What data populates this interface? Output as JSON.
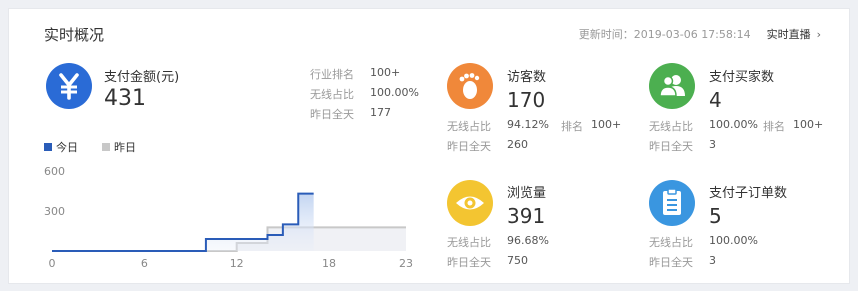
{
  "header": {
    "title": "实时概况",
    "update_label": "更新时间：2019-03-06 17:58:14",
    "live_link": "实时直播"
  },
  "pay_amount": {
    "icon": "yen-icon",
    "color": "#2a6bd6",
    "label": "支付金额(元)",
    "value": "431",
    "stats": [
      {
        "k": "行业排名",
        "v": "100+"
      },
      {
        "k": "无线占比",
        "v": "100.00%"
      },
      {
        "k": "昨日全天",
        "v": "177"
      }
    ]
  },
  "visitors": {
    "icon": "footprint-icon",
    "color": "#f0883a",
    "label": "访客数",
    "value": "170",
    "wireless_k": "无线占比",
    "wireless_v": "94.12%",
    "rank_k": "排名",
    "rank_v": "100+",
    "yesterday_k": "昨日全天",
    "yesterday_v": "260"
  },
  "buyers": {
    "icon": "users-icon",
    "color": "#4caf50",
    "label": "支付买家数",
    "value": "4",
    "wireless_k": "无线占比",
    "wireless_v": "100.00%",
    "rank_k": "排名",
    "rank_v": "100+",
    "yesterday_k": "昨日全天",
    "yesterday_v": "3"
  },
  "pageviews": {
    "icon": "eye-icon",
    "color": "#f3c531",
    "label": "浏览量",
    "value": "391",
    "wireless_k": "无线占比",
    "wireless_v": "96.68%",
    "yesterday_k": "昨日全天",
    "yesterday_v": "750"
  },
  "suborders": {
    "icon": "clipboard-icon",
    "color": "#3a96e0",
    "label": "支付子订单数",
    "value": "5",
    "wireless_k": "无线占比",
    "wireless_v": "100.00%",
    "yesterday_k": "昨日全天",
    "yesterday_v": "3"
  },
  "chart_data": {
    "type": "line",
    "x": [
      0,
      1,
      2,
      3,
      4,
      5,
      6,
      7,
      8,
      9,
      10,
      11,
      12,
      13,
      14,
      15,
      16,
      17,
      18,
      19,
      20,
      21,
      22,
      23
    ],
    "xticks": [
      0,
      6,
      12,
      18,
      23
    ],
    "yticks": [
      600,
      300
    ],
    "ylim": [
      0,
      600
    ],
    "series": [
      {
        "name": "今日",
        "color": "#2a5cb8",
        "values": [
          0,
          0,
          0,
          0,
          0,
          0,
          0,
          0,
          0,
          0,
          90,
          90,
          90,
          90,
          120,
          200,
          430,
          430,
          null,
          null,
          null,
          null,
          null,
          null
        ]
      },
      {
        "name": "昨日",
        "color": "#c8c8c8",
        "values": [
          0,
          0,
          0,
          0,
          0,
          0,
          0,
          0,
          0,
          0,
          0,
          0,
          60,
          60,
          177,
          177,
          177,
          177,
          177,
          177,
          177,
          177,
          177,
          177
        ]
      }
    ]
  }
}
